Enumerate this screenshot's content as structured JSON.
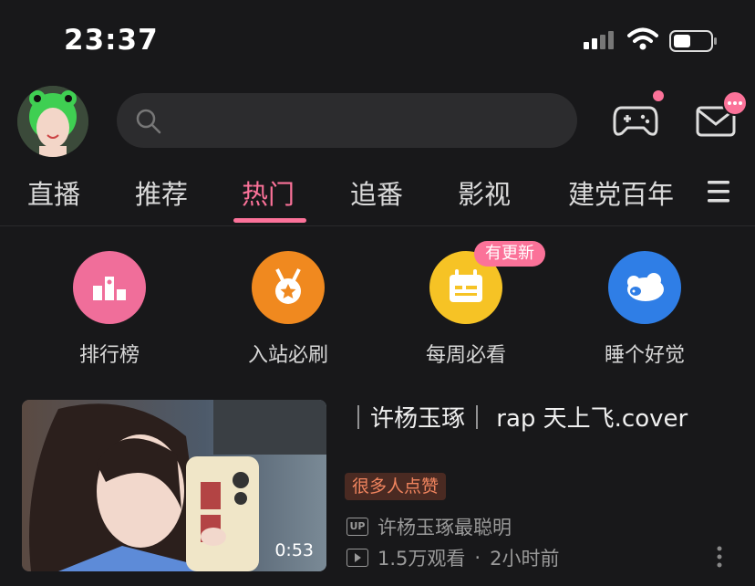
{
  "status_bar": {
    "time": "23:37"
  },
  "header": {
    "search_placeholder": ""
  },
  "tabs": [
    {
      "label": "直播"
    },
    {
      "label": "推荐"
    },
    {
      "label": "热门",
      "active": true
    },
    {
      "label": "追番"
    },
    {
      "label": "影视"
    },
    {
      "label": "建党百年"
    }
  ],
  "entries": [
    {
      "label": "排行榜",
      "color": "#f06e9a",
      "icon": "ranking-icon"
    },
    {
      "label": "入站必刷",
      "color": "#f0891f",
      "icon": "medal-icon"
    },
    {
      "label": "每周必看",
      "color": "#f6c325",
      "icon": "calendar-icon",
      "badge": "有更新"
    },
    {
      "label": "睡个好觉",
      "color": "#2f7ee6",
      "icon": "sheep-icon"
    }
  ],
  "video": {
    "title": "｜许杨玉琢｜ rap 天上飞.cover",
    "tag": "很多人点赞",
    "uploader": "许杨玉琢最聪明",
    "up_label": "UP",
    "views": "1.5万观看",
    "separator": "·",
    "time_ago": "2小时前",
    "duration": "0:53"
  },
  "colors": {
    "accent": "#fb7299",
    "background": "#18181a"
  }
}
